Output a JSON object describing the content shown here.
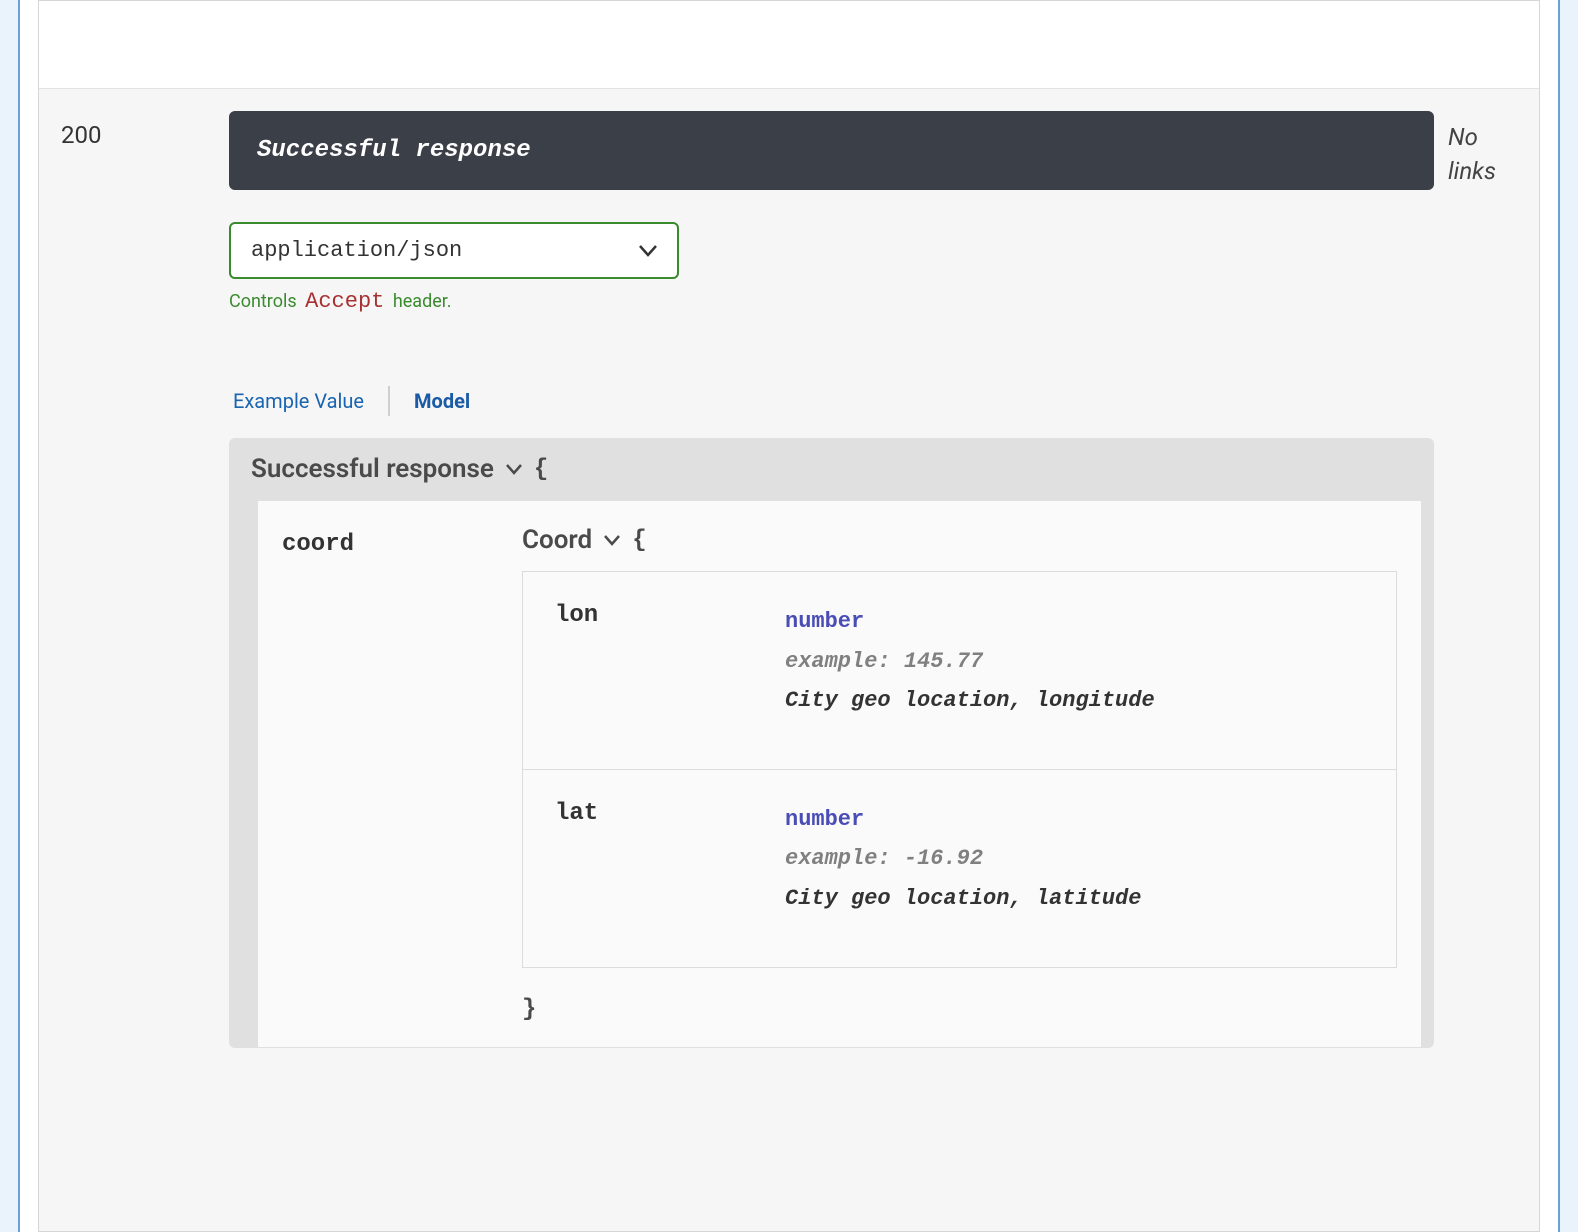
{
  "response": {
    "code": "200",
    "description": "Successful response",
    "links": "No links"
  },
  "contentType": {
    "selected": "application/json",
    "caption_prefix": "Controls",
    "caption_accept": "Accept",
    "caption_suffix": "header."
  },
  "tabs": {
    "example": "Example Value",
    "model": "Model"
  },
  "model": {
    "title": "Successful response",
    "open_brace": "{",
    "close_brace": "}",
    "property_key": "coord",
    "coord": {
      "title": "Coord",
      "open_brace": "{",
      "close_brace": "}",
      "props": {
        "lon": {
          "name": "lon",
          "type": "number",
          "example": "example: 145.77",
          "desc": "City geo location, longitude"
        },
        "lat": {
          "name": "lat",
          "type": "number",
          "example": "example: -16.92",
          "desc": "City geo location, latitude"
        }
      }
    }
  }
}
